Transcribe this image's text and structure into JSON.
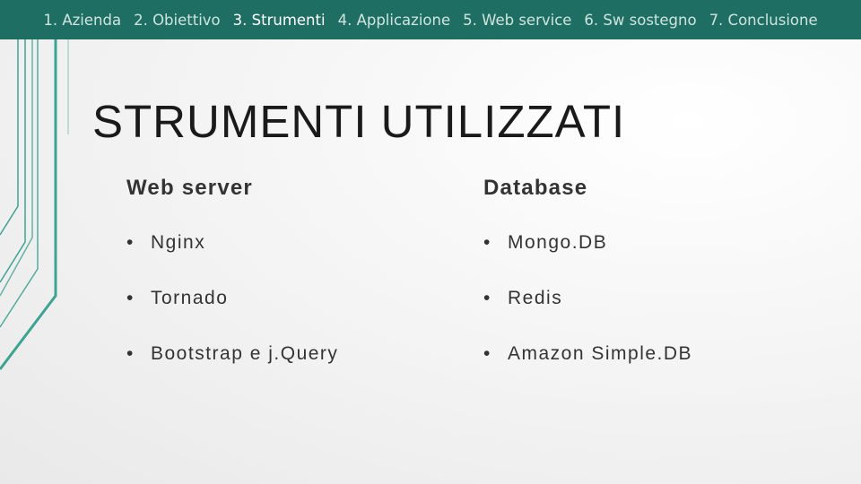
{
  "nav": {
    "items": [
      {
        "label": "1. Azienda",
        "active": false
      },
      {
        "label": "2. Obiettivo",
        "active": false
      },
      {
        "label": "3. Strumenti",
        "active": true
      },
      {
        "label": "4. Applicazione",
        "active": false
      },
      {
        "label": "5. Web service",
        "active": false
      },
      {
        "label": "6. Sw sostegno",
        "active": false
      },
      {
        "label": "7. Conclusione",
        "active": false
      }
    ],
    "background": "#1f6e63",
    "text_color": "#cfe4df",
    "active_color": "#ffffff"
  },
  "slide": {
    "title": "STRUMENTI UTILIZZATI",
    "accent_color": "#2a9a87",
    "columns": [
      {
        "heading": "Web server",
        "items": [
          "Nginx",
          "Tornado",
          "Bootstrap e j.Query"
        ]
      },
      {
        "heading": "Database",
        "items": [
          "Mongo.DB",
          "Redis",
          "Amazon Simple.DB"
        ]
      }
    ],
    "bullet": "•"
  }
}
